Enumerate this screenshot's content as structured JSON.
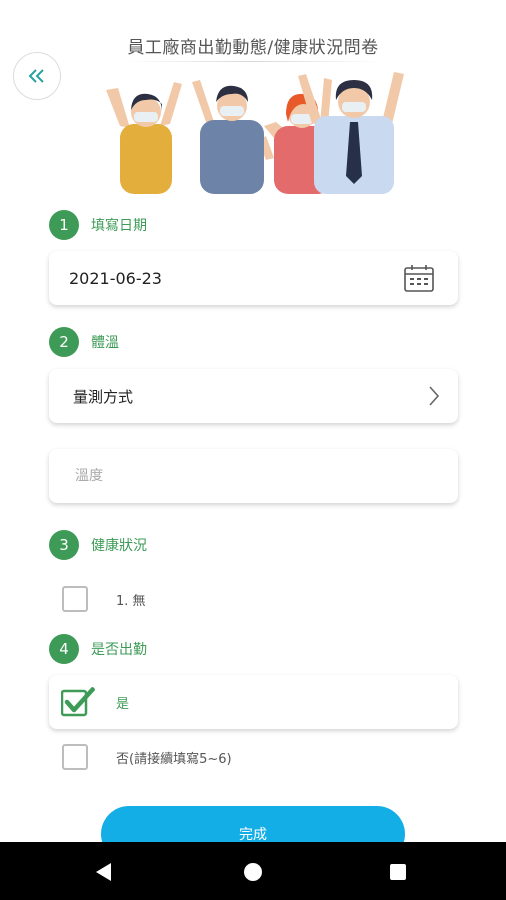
{
  "header": {
    "title": "員工廠商出勤動態/健康狀況問卷",
    "back_icon": "double-chevron-left-icon"
  },
  "colors": {
    "accent_green": "#3e9b57",
    "button_blue": "#14aee6",
    "back_teal": "#27a3a0"
  },
  "sections": {
    "date": {
      "number": "1",
      "label": "填寫日期",
      "value": "2021-06-23",
      "icon": "calendar-icon"
    },
    "temperature": {
      "number": "2",
      "label": "體溫",
      "method_label": "量測方式",
      "temp_placeholder": "溫度"
    },
    "health": {
      "number": "3",
      "label": "健康狀況",
      "option_1": "1. 無",
      "option_1_checked": false
    },
    "attendance": {
      "number": "4",
      "label": "是否出勤",
      "option_yes": "是",
      "option_yes_checked": true,
      "option_no": "否(請接續填寫5~6)",
      "option_no_checked": false
    }
  },
  "submit_label": "完成",
  "navbar": {
    "back_icon": "nav-back-icon",
    "home_icon": "nav-home-icon",
    "recent_icon": "nav-recent-icon"
  }
}
